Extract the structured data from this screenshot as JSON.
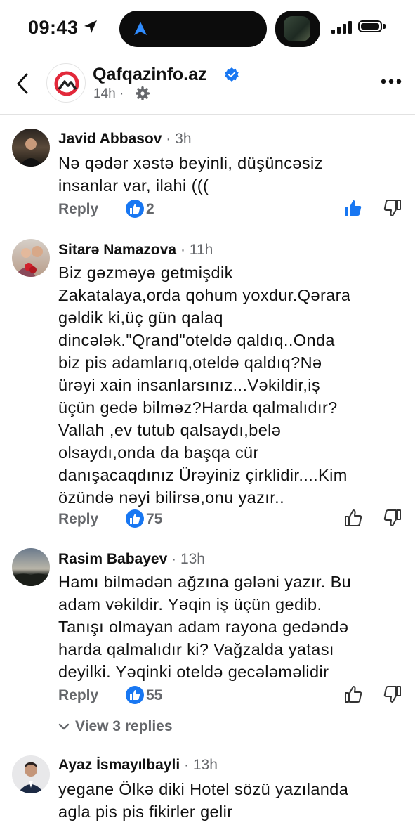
{
  "status_bar": {
    "time": "09:43"
  },
  "header": {
    "page_name": "Qafqazinfo.az",
    "time_ago": "14h",
    "separator": "·"
  },
  "comments": [
    {
      "name": "Javid Abbasov",
      "dot": "·",
      "time": "3h",
      "text": "Nə qədər xəstə beyinli, düşüncəsiz\ninsanlar var, ilahi (((",
      "reply_label": "Reply",
      "likes": "2",
      "liked": true
    },
    {
      "name": "Sitarə Namazova",
      "dot": "·",
      "time": "11h",
      "text": "Biz gəzməyə getmişdik\nZakatalaya,orda qohum yoxdur.Qərara\ngəldik ki,üç gün qalaq\ndincələk.\"Qrand\"oteldə qaldıq..Onda\nbiz pis adamlarıq,oteldə qaldıq?Nə\nürəyi xain insanlarsınız...Vəkildir,iş\nüçün gedə bilməz?Harda qalmalıdır?\nVallah ,ev tutub qalsaydı,belə\nolsaydı,onda da başqa cür\ndanışacaqdınız Ürəyiniz  çirklidir....Kim\nözündə nəyi bilirsə,onu yazır..",
      "reply_label": "Reply",
      "likes": "75",
      "liked": false
    },
    {
      "name": "Rasim Babayev",
      "dot": "·",
      "time": "13h",
      "text": "Hamı bilmədən ağzına gələni yazır. Bu\nadam vəkildir. Yəqin iş üçün gedib.\nTanışı olmayan adam rayona gedəndə\nharda qalmalıdır ki? Vağzalda yatası\ndeyilki. Yəqinki oteldə gecələməlidir",
      "reply_label": "Reply",
      "likes": "55",
      "liked": false,
      "view_replies": "View 3 replies"
    },
    {
      "name": "Ayaz İsmayılbayli",
      "dot": "·",
      "time": "13h",
      "text": "yegane Ölkə diki Hotel sözü yazılanda\nagla pis pis fikirler gelir"
    }
  ],
  "colors": {
    "accent": "#1877f2",
    "muted": "#65676b",
    "logo_red": "#e2283a"
  }
}
